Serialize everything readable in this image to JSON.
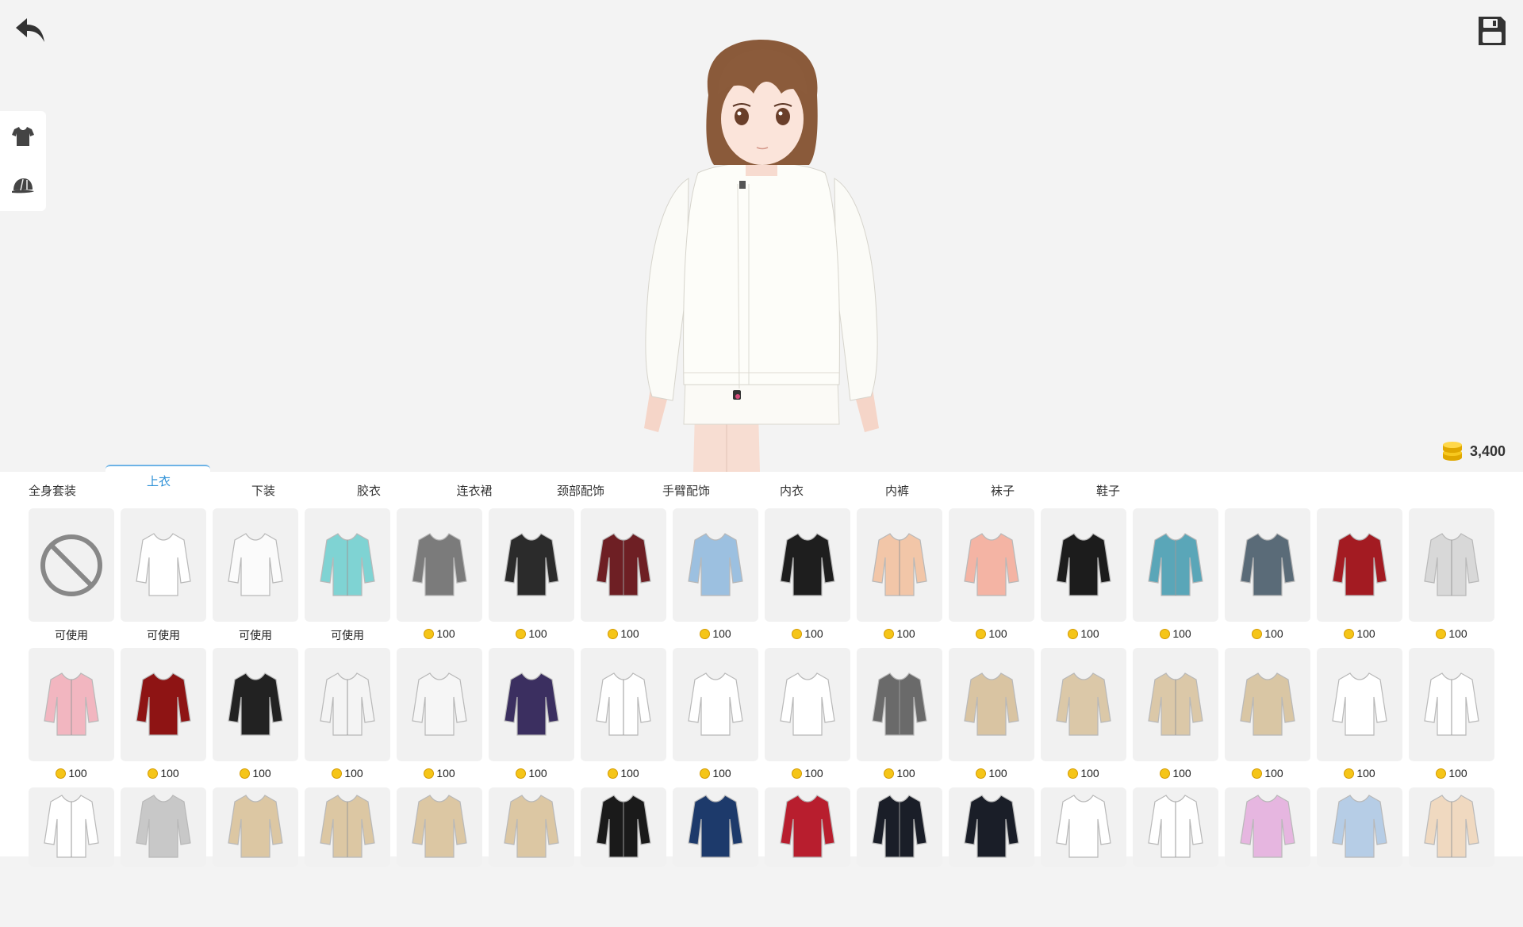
{
  "toolbar": {
    "back_icon": "undo-arrow-icon",
    "save_icon": "floppy-disk-icon"
  },
  "side_panel": [
    {
      "name": "clothing",
      "icon": "tshirt-icon"
    },
    {
      "name": "accessories",
      "icon": "cap-icon"
    }
  ],
  "wallet": {
    "amount": "3,400",
    "icon": "coin-stack-icon"
  },
  "tabs": [
    {
      "label": "全身套装",
      "active": false
    },
    {
      "label": "上衣",
      "active": true
    },
    {
      "label": "下装",
      "active": false
    },
    {
      "label": "胶衣",
      "active": false
    },
    {
      "label": "连衣裙",
      "active": false
    },
    {
      "label": "颈部配饰",
      "active": false
    },
    {
      "label": "手臂配饰",
      "active": false
    },
    {
      "label": "内衣",
      "active": false
    },
    {
      "label": "内裤",
      "active": false
    },
    {
      "label": "袜子",
      "active": false
    },
    {
      "label": "鞋子",
      "active": false
    }
  ],
  "items_row1": [
    {
      "price": "可使用",
      "owned": true,
      "color": "none"
    },
    {
      "price": "可使用",
      "owned": true,
      "color": "#ffffff"
    },
    {
      "price": "可使用",
      "owned": true,
      "color": "#fbfbfb"
    },
    {
      "price": "可使用",
      "owned": true,
      "color": "#7fd3d3"
    },
    {
      "price": "100",
      "owned": false,
      "color": "#7b7b7b"
    },
    {
      "price": "100",
      "owned": false,
      "color": "#2b2b2b"
    },
    {
      "price": "100",
      "owned": false,
      "color": "#6e1f24"
    },
    {
      "price": "100",
      "owned": false,
      "color": "#9cc0e0"
    },
    {
      "price": "100",
      "owned": false,
      "color": "#1e1e1e"
    },
    {
      "price": "100",
      "owned": false,
      "color": "#f2c6a8"
    },
    {
      "price": "100",
      "owned": false,
      "color": "#f4b4a4"
    },
    {
      "price": "100",
      "owned": false,
      "color": "#1c1c1c"
    },
    {
      "price": "100",
      "owned": false,
      "color": "#5aa6b8"
    },
    {
      "price": "100",
      "owned": false,
      "color": "#5a6b78"
    },
    {
      "price": "100",
      "owned": false,
      "color": "#a31b22"
    },
    {
      "price": "100",
      "owned": false,
      "color": "#d8d8d8"
    }
  ],
  "items_row2": [
    {
      "price": "100",
      "color": "#f2b6c0"
    },
    {
      "price": "100",
      "color": "#8e1414"
    },
    {
      "price": "100",
      "color": "#222222"
    },
    {
      "price": "100",
      "color": "#f4f4f4"
    },
    {
      "price": "100",
      "color": "#f6f6f6"
    },
    {
      "price": "100",
      "color": "#3b2f60"
    },
    {
      "price": "100",
      "color": "#ffffff"
    },
    {
      "price": "100",
      "color": "#ffffff"
    },
    {
      "price": "100",
      "color": "#ffffff"
    },
    {
      "price": "100",
      "color": "#6a6a6a"
    },
    {
      "price": "100",
      "color": "#d9c4a2"
    },
    {
      "price": "100",
      "color": "#dbc8a8"
    },
    {
      "price": "100",
      "color": "#dbc8a8"
    },
    {
      "price": "100",
      "color": "#d9c6a4"
    },
    {
      "price": "100",
      "color": "#ffffff"
    },
    {
      "price": "100",
      "color": "#ffffff"
    }
  ],
  "items_row3": [
    {
      "color": "#ffffff"
    },
    {
      "color": "#c8c8c8"
    },
    {
      "color": "#dcc7a3"
    },
    {
      "color": "#dcc7a3"
    },
    {
      "color": "#dcc7a3"
    },
    {
      "color": "#dcc7a3"
    },
    {
      "color": "#1a1a1a"
    },
    {
      "color": "#1d3a6b"
    },
    {
      "color": "#b81e2e"
    },
    {
      "color": "#1a1e28"
    },
    {
      "color": "#1a1e28"
    },
    {
      "color": "#ffffff"
    },
    {
      "color": "#ffffff"
    },
    {
      "color": "#e6b6e0"
    },
    {
      "color": "#b6cde6"
    },
    {
      "color": "#f0d9c0"
    }
  ]
}
